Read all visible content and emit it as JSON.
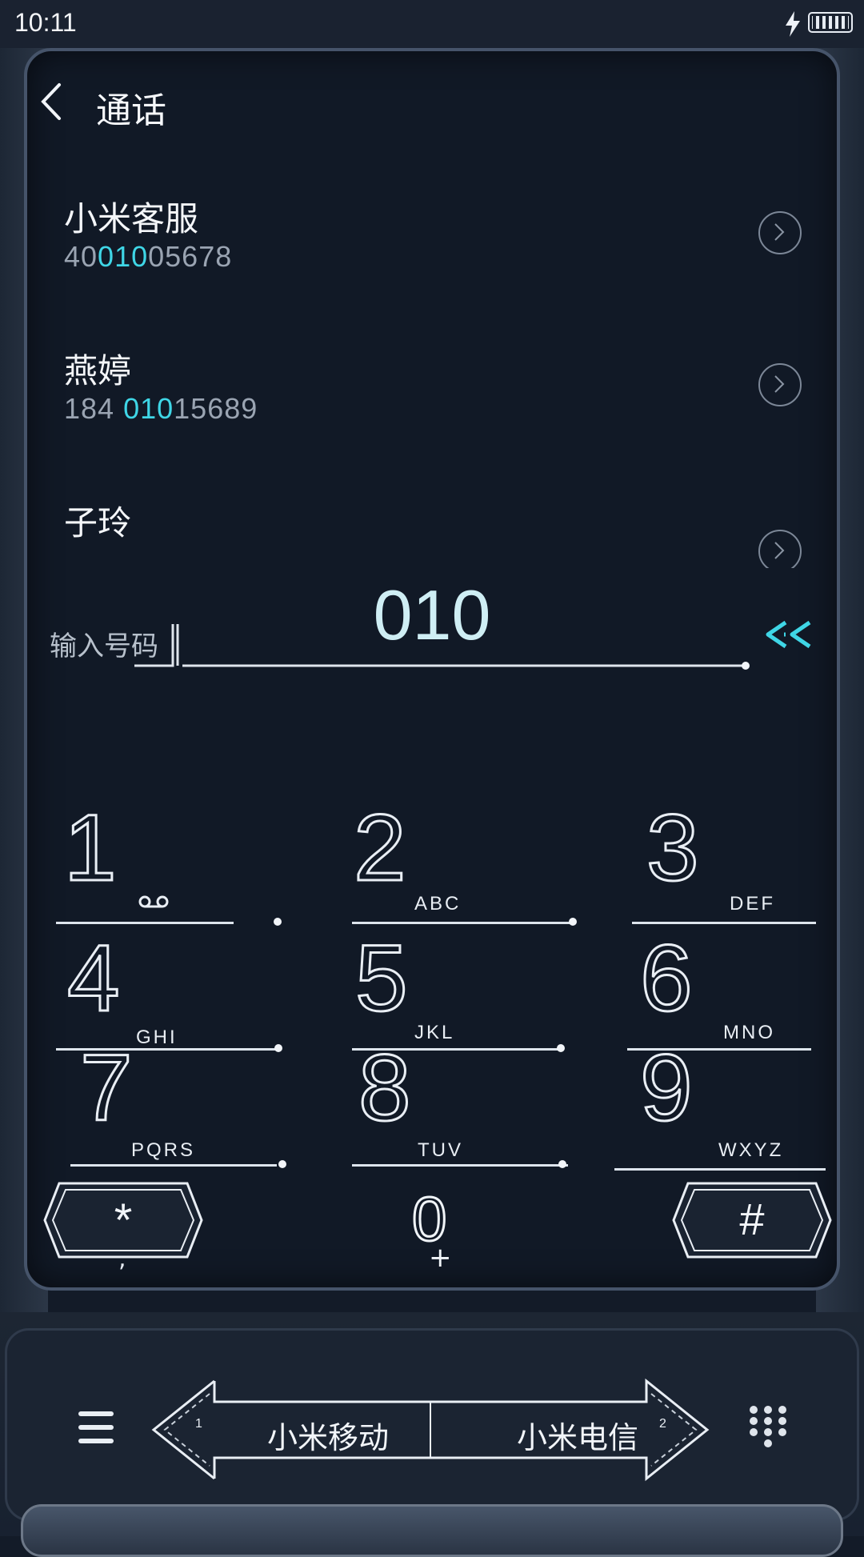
{
  "status_bar": {
    "time": "10:11",
    "charging": true
  },
  "header": {
    "title": "通话",
    "back_icon": "chevron-left-icon"
  },
  "contacts": [
    {
      "name": "小米客服",
      "number_before": "40",
      "number_match": "010",
      "number_after": "05678"
    },
    {
      "name": "燕婷",
      "number_before": "184 ",
      "number_match": "010",
      "number_after": "15689"
    },
    {
      "name": "子玲",
      "number_before": "",
      "number_match": "",
      "number_after": ""
    }
  ],
  "number_input": {
    "label": "输入号码",
    "value": "010",
    "delete_icon": "backspace-icon"
  },
  "keypad": {
    "keys": [
      {
        "digit": "1",
        "letters": "",
        "icon": "voicemail-icon"
      },
      {
        "digit": "2",
        "letters": "ABC"
      },
      {
        "digit": "3",
        "letters": "DEF"
      },
      {
        "digit": "4",
        "letters": "GHI"
      },
      {
        "digit": "5",
        "letters": "JKL"
      },
      {
        "digit": "6",
        "letters": "MNO"
      },
      {
        "digit": "7",
        "letters": "PQRS"
      },
      {
        "digit": "8",
        "letters": "TUV"
      },
      {
        "digit": "9",
        "letters": "WXYZ"
      }
    ],
    "star": {
      "symbol": "*",
      "sub": ","
    },
    "zero": {
      "digit": "0",
      "sub": "+"
    },
    "hash": {
      "symbol": "#"
    }
  },
  "bottom_bar": {
    "menu_icon": "menu-icon",
    "sim1": {
      "label": "小米移动",
      "slot": "1"
    },
    "sim2": {
      "label": "小米电信",
      "slot": "2"
    },
    "dialpad_icon": "dialpad-icon"
  },
  "colors": {
    "accent": "#3fd6e6",
    "background": "#111926",
    "text": "#eef2f7"
  }
}
